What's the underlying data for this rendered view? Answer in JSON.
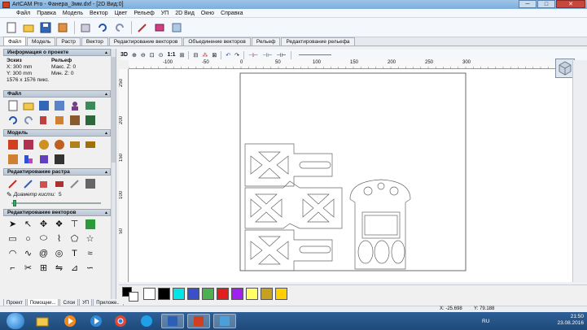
{
  "window": {
    "title": "ArtCAM Pro - Фанера_3мм.dxf - [2D Вид:0]",
    "minimize": "─",
    "maximize": "□",
    "close": "✕"
  },
  "menu": [
    "Файл",
    "Правка",
    "Модель",
    "Вектор",
    "Цвет",
    "Рельеф",
    "УП",
    "2D Вид",
    "Окно",
    "Справка"
  ],
  "ribbon_tabs": [
    {
      "label": "Файл",
      "active": true
    },
    {
      "label": "Модель",
      "active": false
    },
    {
      "label": "Растр",
      "active": false
    },
    {
      "label": "Вектор",
      "active": false
    },
    {
      "label": "Редактирование векторов",
      "active": false
    },
    {
      "label": "Объединение векторов",
      "active": false
    },
    {
      "label": "Рельеф",
      "active": false
    },
    {
      "label": "Редактирование рельефа",
      "active": false
    }
  ],
  "project_info": {
    "header": "Информация о проекте",
    "sketch_label": "Эскиз",
    "relief_label": "Рельеф",
    "x": "X: 300 mm",
    "max_z": "Макс. Z: 0",
    "y": "Y: 300 mm",
    "min_z": "Мин. Z: 0",
    "pixels": "1576 x 1576 пикс."
  },
  "sections": {
    "file": "Файл",
    "model": "Модель",
    "raster_edit": "Редактирование растра",
    "vector_edit": "Редактирование векторов"
  },
  "brush": {
    "label": "Диаметр кисти:",
    "value": "5",
    "level": 0.02
  },
  "panel_tabs": [
    "Проект",
    "Помощни...",
    "Слои",
    "УП",
    "Приложе..."
  ],
  "view_toolbar": {
    "mode": "3D",
    "scale": "1:1"
  },
  "ruler_x": [
    "-100",
    "-50",
    "0",
    "50",
    "100",
    "150",
    "200",
    "250",
    "300"
  ],
  "ruler_y": [
    "250",
    "200",
    "150",
    "100",
    "50"
  ],
  "palette_colors": [
    "#000000",
    "#ffffff",
    "#00e5e5",
    "#3b4fc8",
    "#4caf50",
    "#e01e1e",
    "#a020f0",
    "#ffff66",
    "#c8a020",
    "#ffd000"
  ],
  "status": {
    "x": "X: -25.698",
    "y": "Y: 79.188"
  },
  "taskbar": {
    "lang": "RU",
    "time": "21:50",
    "date": "23.08.2016"
  },
  "icons": {
    "toolbar": [
      "new-file-icon",
      "open-folder-icon",
      "save-icon",
      "import-icon",
      "model-icon",
      "undo-icon",
      "redo-icon",
      "magic-wand-icon",
      "book-icon",
      "export-icon"
    ],
    "file_section_row1": [
      "new-file-icon",
      "open-folder-icon",
      "save-icon",
      "save-as-icon",
      "user-icon",
      "photo-icon"
    ],
    "file_section_row2": [
      "undo-icon",
      "redo-icon",
      "copy-icon",
      "paste-icon",
      "relief-icon",
      "grid-icon"
    ]
  }
}
